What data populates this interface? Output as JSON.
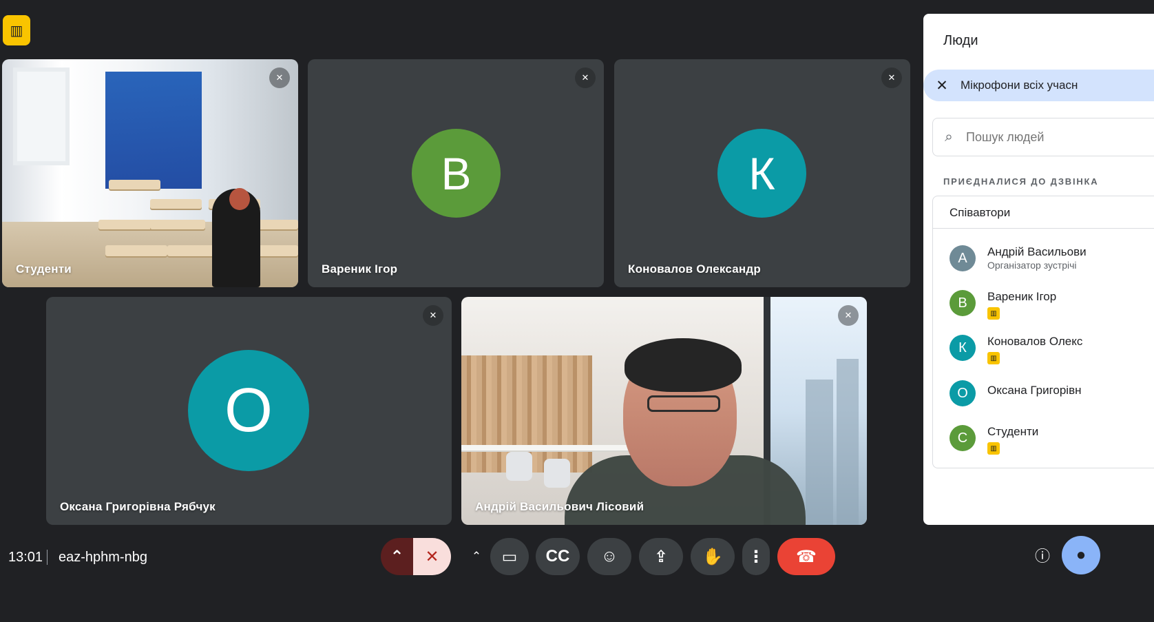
{
  "top_indicator": {
    "icon": "captions-off-icon"
  },
  "tiles": [
    {
      "name": "Студенти",
      "muted": true
    },
    {
      "name": "Вареник Ігор",
      "initial": "В",
      "color": "#5b9b3a",
      "muted": true
    },
    {
      "name": "Коновалов Олександр",
      "initial": "К",
      "color": "#0b9ba6",
      "muted": true
    },
    {
      "name": "Оксана Григорівна Рябчук",
      "initial": "О",
      "color": "#0b9ba6",
      "muted": true
    },
    {
      "name": "Андрій Васильович Лісовий",
      "muted": true
    }
  ],
  "panel": {
    "title": "Люди",
    "mic_notice": "Мікрофони всіх учасн",
    "search_placeholder": "Пошук людей",
    "section_label": "ПРИЄДНАЛИСЯ ДО ДЗВІНКА",
    "group_label": "Співавтори",
    "people": [
      {
        "initial": "А",
        "name": "Андрій Васильови",
        "sub": "Організатор зустрічі",
        "color": "#6f8a96"
      },
      {
        "initial": "В",
        "name": "Вареник Ігор",
        "color": "#5b9b3a",
        "video_off": true
      },
      {
        "initial": "К",
        "name": "Коновалов Олекс",
        "color": "#0b9ba6",
        "video_off": true
      },
      {
        "initial": "О",
        "name": "Оксана Григорівн",
        "color": "#0b9ba6"
      },
      {
        "initial": "С",
        "name": "Студенти",
        "color": "#5b9b3a",
        "video_off": true
      }
    ]
  },
  "bottom_bar": {
    "time": "13:01",
    "meeting_code": "eaz-hphm-nbg"
  },
  "controls": {
    "mic_icon": "mic-off-icon",
    "camera_icon": "videocam-icon",
    "captions_icon": "closed-captions-icon",
    "emoji_icon": "emoji-icon",
    "present_icon": "present-screen-icon",
    "raise_hand_icon": "raise-hand-icon",
    "more_icon": "more-vertical-icon",
    "leave_icon": "call-end-icon",
    "info_icon": "info-icon",
    "people_icon": "people-icon"
  }
}
